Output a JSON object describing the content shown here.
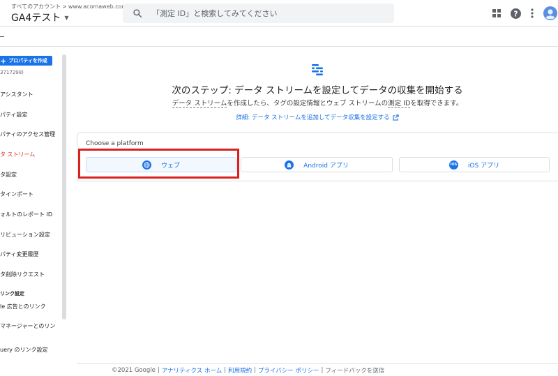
{
  "header": {
    "breadcrumb_root": "すべてのアカウント",
    "breadcrumb_sep": ">",
    "breadcrumb_site": "www.acomaweb.com/",
    "property_name": "GA4テスト",
    "search_placeholder": "「測定 ID」と検索してみてください",
    "icons": [
      "search-icon",
      "apps-icon",
      "help-icon",
      "more-vert-icon",
      "account-avatar-icon"
    ]
  },
  "sidebar": {
    "create_button": "プロパティを作成",
    "property_id": "3717298)",
    "items": [
      {
        "label": "アシスタント"
      },
      {
        "label": "パティ設定"
      },
      {
        "label": "パティのアクセス管理"
      },
      {
        "label": "タ ストリーム",
        "active": true
      },
      {
        "label": "タ設定"
      },
      {
        "label": "タインポート"
      },
      {
        "label": "ォルトのレポート ID"
      },
      {
        "label": "リビューション設定"
      },
      {
        "label": "パティ変更履歴"
      },
      {
        "label": "タ削除リクエスト"
      }
    ],
    "section_label": "リンク設定",
    "link_items": [
      {
        "label": "le 広告とのリンク"
      },
      {
        "label": "マネージャーとのリン"
      },
      {
        "label": "uery のリンク設定"
      }
    ]
  },
  "main": {
    "title": "次のステップ: データ ストリームを設定してデータの収集を開始する",
    "subtitle_part1": "データ ストリーム",
    "subtitle_part2": "を作成したら、タグの設定情報とウェブ ストリームの",
    "subtitle_part3": "測定 ID",
    "subtitle_part4": "を取得できます。",
    "detail_link": "詳細: データ ストリームを追加してデータ収集を設定する",
    "choose_platform": "Choose a platform",
    "platforms": [
      {
        "label": "ウェブ",
        "icon": "globe-icon"
      },
      {
        "label": "Android アプリ",
        "icon": "android-icon"
      },
      {
        "label": "iOS アプリ",
        "icon": "ios-icon",
        "badge": "iOS"
      }
    ],
    "accent_color": "#1a73e8",
    "highlight_color": "#d9211f"
  },
  "footer": {
    "copyright": "©2021 Google",
    "sep": "|",
    "links": [
      "アナリティクス ホーム",
      "利用規約",
      "プライバシー ポリシー"
    ],
    "feedback": "フィードバックを送信"
  }
}
